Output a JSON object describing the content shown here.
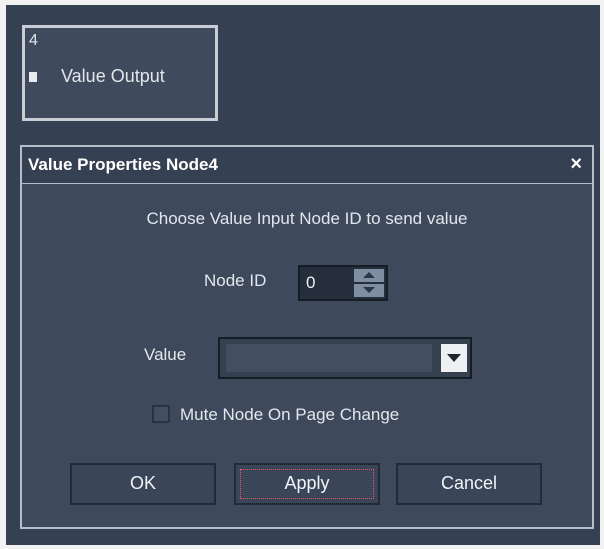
{
  "node": {
    "id": "4",
    "label": "Value Output"
  },
  "dialog": {
    "title": "Value Properties Node4",
    "close_glyph": "×",
    "instruction": "Choose Value Input Node ID to send value",
    "node_id_label": "Node ID",
    "node_id_value": "0",
    "value_label": "Value",
    "value_selected": "",
    "mute_label": "Mute Node On Page Change",
    "mute_checked": false,
    "buttons": {
      "ok": "OK",
      "apply": "Apply",
      "cancel": "Cancel"
    }
  },
  "colors": {
    "background": "#354152",
    "dialog": "#3e4a5b",
    "text": "#e3e7ed",
    "focus": "#e05a6b"
  }
}
